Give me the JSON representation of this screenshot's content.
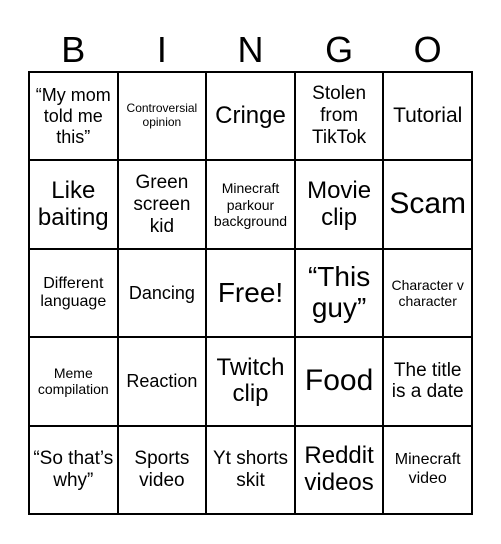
{
  "header": {
    "letters": [
      "B",
      "I",
      "N",
      "G",
      "O"
    ]
  },
  "cells": [
    [
      "“My mom told me this”",
      "Controversial opinion",
      "Cringe",
      "Stolen from TikTok",
      "Tutorial"
    ],
    [
      "Like baiting",
      "Green screen kid",
      "Minecraft parkour background",
      "Movie clip",
      "Scam"
    ],
    [
      "Different language",
      "Dancing",
      "Free!",
      "“This guy”",
      "Character v character"
    ],
    [
      "Meme compilation",
      "Reaction",
      "Twitch clip",
      "Food",
      "The title is a date"
    ],
    [
      "“So that’s why”",
      "Sports video",
      "Yt shorts skit",
      "Reddit videos",
      "Minecraft video"
    ]
  ]
}
